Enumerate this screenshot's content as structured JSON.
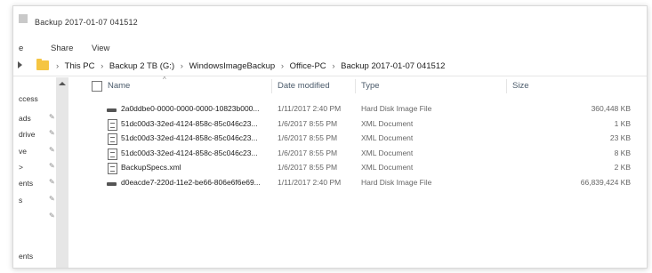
{
  "window": {
    "title": "Backup 2017-01-07 041512"
  },
  "ribbon": {
    "tabs": [
      "e",
      "Share",
      "View"
    ]
  },
  "address": {
    "crumbs": [
      "This PC",
      "Backup 2 TB (G:)",
      "WindowsImageBackup",
      "Office-PC",
      "Backup 2017-01-07 041512"
    ]
  },
  "nav_pane": {
    "items": [
      "ccess",
      "ads",
      "drive",
      "ve",
      ">",
      "ents",
      "s",
      "",
      "",
      "ents"
    ]
  },
  "columns": {
    "name": "Name",
    "date": "Date modified",
    "type": "Type",
    "size": "Size"
  },
  "files": [
    {
      "icon": "hard-disk-icon",
      "name": "2a0ddbe0-0000-0000-0000-10823b000...",
      "date": "1/11/2017 2:40 PM",
      "type": "Hard Disk Image File",
      "size": "360,448 KB"
    },
    {
      "icon": "xml-document-icon",
      "name": "51dc00d3-32ed-4124-858c-85c046c23...",
      "date": "1/6/2017 8:55 PM",
      "type": "XML Document",
      "size": "1 KB"
    },
    {
      "icon": "xml-document-icon",
      "name": "51dc00d3-32ed-4124-858c-85c046c23...",
      "date": "1/6/2017 8:55 PM",
      "type": "XML Document",
      "size": "23 KB"
    },
    {
      "icon": "xml-document-icon",
      "name": "51dc00d3-32ed-4124-858c-85c046c23...",
      "date": "1/6/2017 8:55 PM",
      "type": "XML Document",
      "size": "8 KB"
    },
    {
      "icon": "xml-document-icon",
      "name": "BackupSpecs.xml",
      "date": "1/6/2017 8:55 PM",
      "type": "XML Document",
      "size": "2 KB"
    },
    {
      "icon": "hard-disk-icon",
      "name": "d0eacde7-220d-11e2-be66-806e6f6e69...",
      "date": "1/11/2017 2:40 PM",
      "type": "Hard Disk Image File",
      "size": "66,839,424 KB"
    }
  ]
}
